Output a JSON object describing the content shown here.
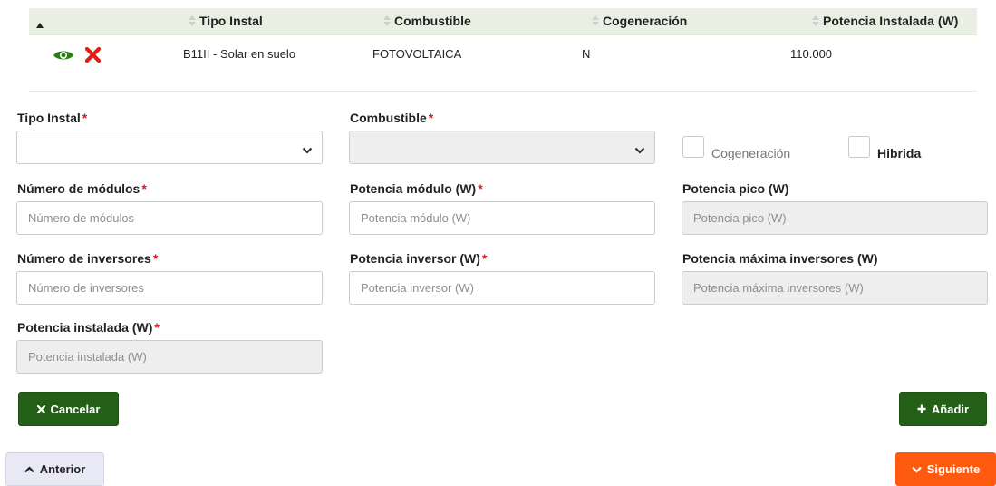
{
  "table": {
    "headers": [
      "Tipo Instal",
      "Combustible",
      "Cogeneración",
      "Potencia Instalada (W)"
    ],
    "rows": [
      {
        "tipo_instal": "B11II - Solar en suelo",
        "combustible": "FOTOVOLTAICA",
        "cogeneracion": "N",
        "potencia": "110.000"
      }
    ]
  },
  "form": {
    "tipo_instal": {
      "label": "Tipo Instal",
      "required": "*",
      "value": ""
    },
    "combustible": {
      "label": "Combustible",
      "required": "*",
      "value": ""
    },
    "cogeneracion": {
      "label": "Cogeneración",
      "checked": false
    },
    "hibrida": {
      "label": "Hibrida",
      "checked": false
    },
    "num_modulos": {
      "label": "Número de módulos",
      "required": "*",
      "placeholder": "Número de módulos"
    },
    "potencia_modulo": {
      "label": "Potencia módulo (W)",
      "required": "*",
      "placeholder": "Potencia módulo (W)"
    },
    "potencia_pico": {
      "label": "Potencia pico (W)",
      "placeholder": "Potencia pico (W)"
    },
    "num_inversores": {
      "label": "Número de inversores",
      "required": "*",
      "placeholder": "Número de inversores"
    },
    "potencia_inversor": {
      "label": "Potencia inversor (W)",
      "required": "*",
      "placeholder": "Potencia inversor (W)"
    },
    "potencia_max_inversores": {
      "label": "Potencia máxima inversores (W)",
      "placeholder": "Potencia máxima inversores (W)"
    },
    "potencia_instalada": {
      "label": "Potencia instalada (W)",
      "required": "*",
      "placeholder": "Potencia instalada (W)"
    }
  },
  "buttons": {
    "cancelar": "Cancelar",
    "anadir": "Añadir",
    "anterior": "Anterior",
    "siguiente": "Siguiente"
  },
  "colors": {
    "primary_green": "#235f16",
    "accent_orange": "#ff5a10",
    "required_red": "#d11a2a",
    "header_bg": "#e9f0e3"
  },
  "icons": {
    "view": "eye-icon",
    "delete": "x-icon",
    "sort": "sort-icon",
    "sort_asc": "sort-up-icon",
    "chevron": "chevron-down-icon"
  }
}
